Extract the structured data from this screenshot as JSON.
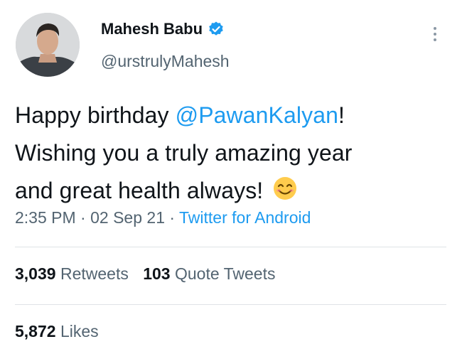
{
  "user": {
    "display_name": "Mahesh Babu",
    "handle": "@urstrulyMahesh",
    "avatar_icon": "profile-photo",
    "verified_icon": "verified-badge-icon"
  },
  "tweet": {
    "text_1": "Happy birthday ",
    "mention": "@PawanKalyan",
    "text_2": "!",
    "line_2": "Wishing you a truly amazing year",
    "line_3": "and great health always! ",
    "emoji": "smiling-face-emoji"
  },
  "meta": {
    "time": "2:35 PM",
    "separator": "·",
    "date": "02 Sep 21",
    "source": "Twitter for Android"
  },
  "stats": {
    "retweets_count": "3,039",
    "retweets_label": "Retweets",
    "quotes_count": "103",
    "quotes_label": "Quote Tweets",
    "likes_count": "5,872",
    "likes_label": "Likes"
  },
  "colors": {
    "link": "#1d9bf0",
    "text": "#0f1419",
    "secondary": "#536471",
    "divider": "#dfe3e7"
  }
}
